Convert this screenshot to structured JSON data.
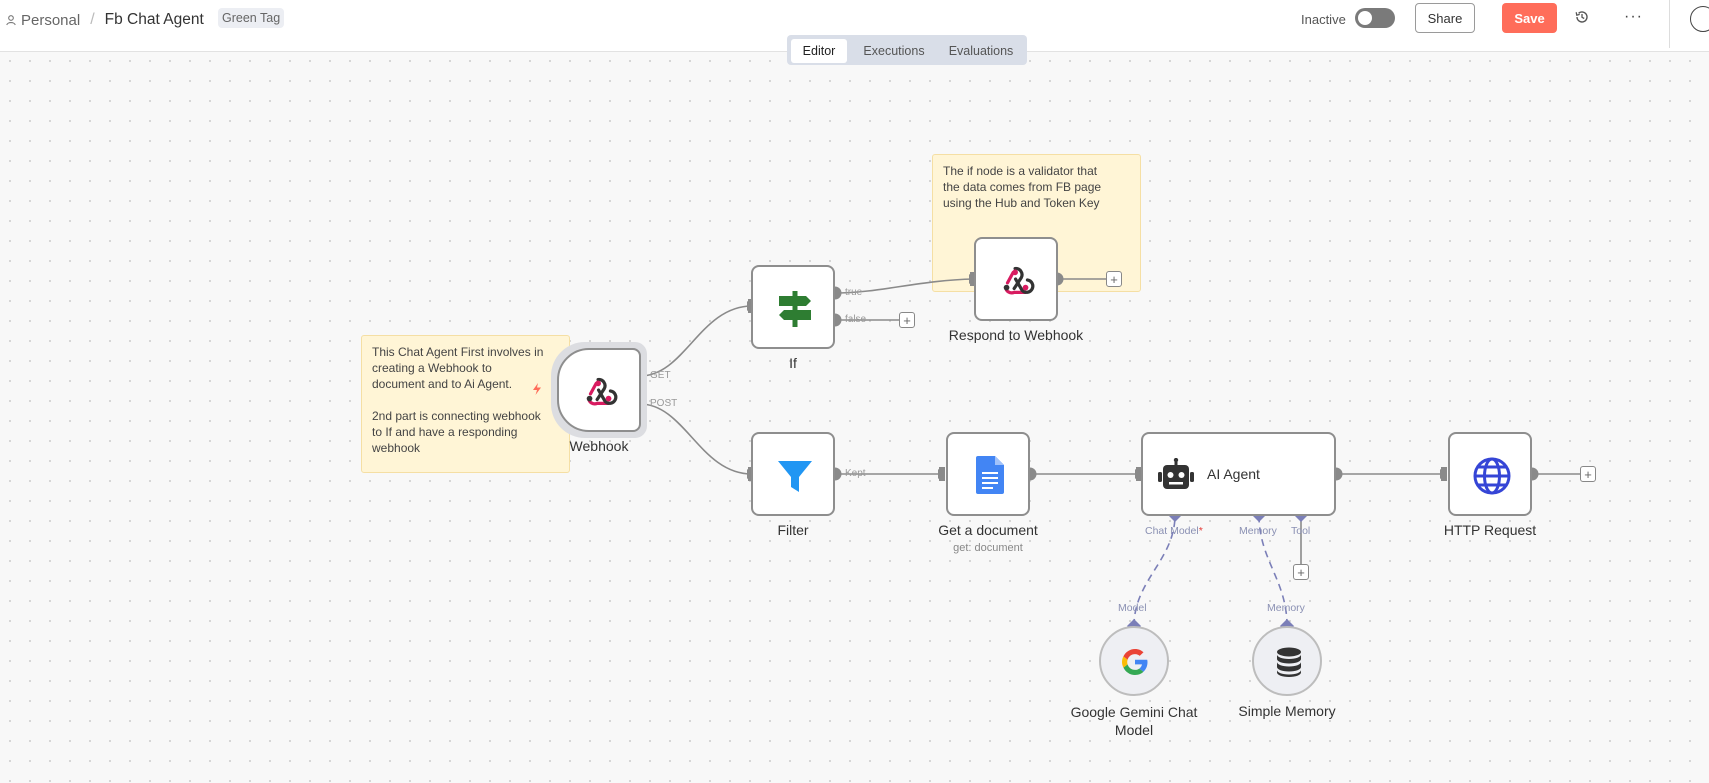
{
  "header": {
    "breadcrumb_personal": "Personal",
    "breadcrumb_separator": "/",
    "workflow_name": "Fb Chat Agent",
    "tag": "Green Tag",
    "status_label": "Inactive",
    "share_label": "Share",
    "save_label": "Save",
    "more_label": "···",
    "active": false
  },
  "tabs": [
    {
      "label": "Editor",
      "active": true
    },
    {
      "label": "Executions",
      "active": false
    },
    {
      "label": "Evaluations",
      "active": false
    }
  ],
  "sticky_notes": [
    {
      "lines": [
        "This Chat Agent First involves in",
        "creating a Webhook to",
        "document and to Ai Agent.",
        "",
        "2nd part is connecting webhook",
        "to If and have a responding",
        "webhook"
      ]
    },
    {
      "lines": [
        "The if node is a validator that",
        "the data comes from FB page",
        "using the Hub and Token Key"
      ]
    }
  ],
  "nodes": {
    "webhook": {
      "label": "Webhook",
      "icon": "webhook-icon",
      "outputs": [
        "GET",
        "POST"
      ]
    },
    "if": {
      "label": "If",
      "icon": "signpost-icon",
      "outputs": [
        "true",
        "false"
      ]
    },
    "respond": {
      "label": "Respond to Webhook",
      "icon": "webhook-icon"
    },
    "filter": {
      "label": "Filter",
      "icon": "filter-icon",
      "outputs": [
        "Kept"
      ]
    },
    "get_document": {
      "label": "Get a document",
      "subtitle": "get: document",
      "icon": "google-docs-icon"
    },
    "ai_agent": {
      "label": "AI Agent",
      "icon": "robot-icon",
      "ports": {
        "chat_model": "Chat Model",
        "required_mark": "*",
        "memory": "Memory",
        "tool": "Tool"
      }
    },
    "http_request": {
      "label": "HTTP Request",
      "icon": "globe-icon"
    },
    "gemini": {
      "label_line1": "Google Gemini Chat",
      "label_line2": "Model",
      "port": "Model",
      "icon": "google-icon"
    },
    "memory": {
      "label": "Simple Memory",
      "port": "Memory",
      "icon": "database-icon"
    }
  },
  "plus_symbol": "+",
  "colors": {
    "accent": "#ff6d5a",
    "node_border": "#8e8e8e",
    "edge": "#8a8a8a",
    "sub_edge": "#7b7fb8",
    "sticky": "#fff5d6",
    "webhook_pink": "#d81b60",
    "if_green": "#2e7d32",
    "filter_blue": "#2196f3",
    "docs_blue": "#4285f4",
    "globe_blue": "#3545d6"
  }
}
